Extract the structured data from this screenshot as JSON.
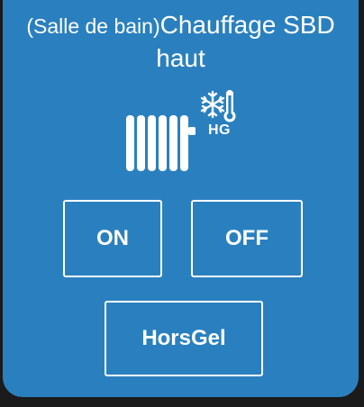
{
  "widget": {
    "room_prefix": "(Salle de bain)",
    "name_part1": "Chauffage SBD",
    "name_part2": "haut",
    "mode_badge": "HG",
    "status_icon": "radiator-icon",
    "mode_icon": "snowflake-thermometer-icon",
    "accent_color": "#2a80bf"
  },
  "buttons": {
    "on_label": "ON",
    "off_label": "OFF",
    "horsgel_label": "HorsGel"
  }
}
